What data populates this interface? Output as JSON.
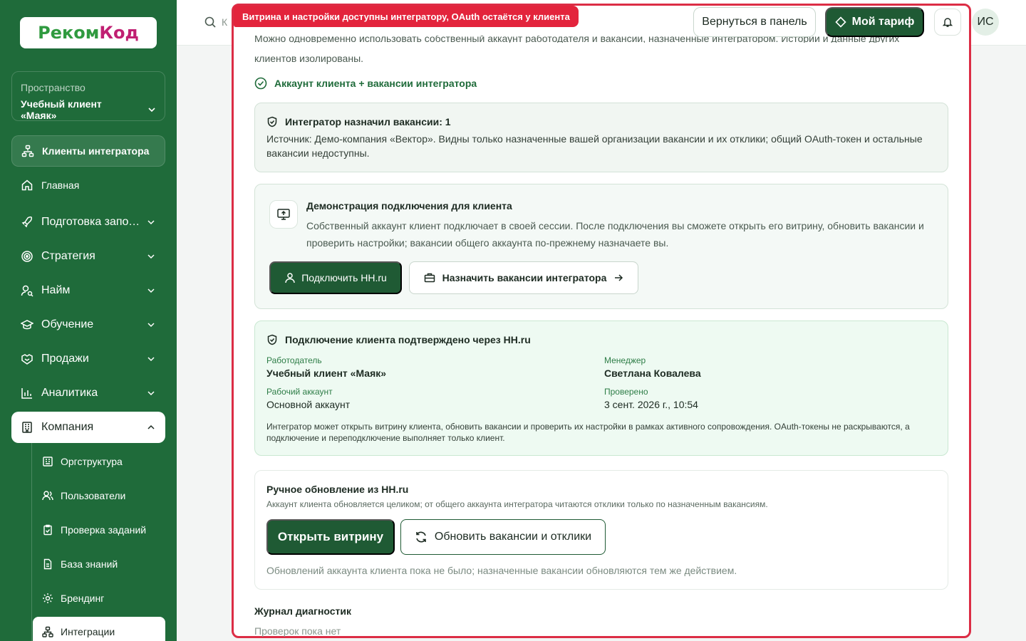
{
  "sidebar": {
    "logo_text_a": "Реком",
    "logo_text_b": "Код",
    "space_label": "Пространство",
    "space_value": "Учебный клиент «Маяк»",
    "items": [
      {
        "label": "Клиенты интегратора",
        "icon": "clients-network-icon"
      },
      {
        "label": "Главная",
        "icon": "home-icon"
      },
      {
        "label": "Подготовка заполнения",
        "icon": "rocket-icon"
      },
      {
        "label": "Стратегия",
        "icon": "target-icon"
      },
      {
        "label": "Найм",
        "icon": "user-search-icon"
      },
      {
        "label": "Обучение",
        "icon": "graduation-icon"
      },
      {
        "label": "Продажи",
        "icon": "handshake-icon"
      },
      {
        "label": "Аналитика",
        "icon": "bar-chart-icon"
      },
      {
        "label": "Компания",
        "icon": "building-icon"
      }
    ],
    "subitems": [
      {
        "label": "Оргструктура",
        "icon": "org-icon"
      },
      {
        "label": "Пользователи",
        "icon": "users-icon"
      },
      {
        "label": "Проверка заданий",
        "icon": "clipboard-check-icon"
      },
      {
        "label": "База знаний",
        "icon": "document-icon"
      },
      {
        "label": "Брендинг",
        "icon": "gear-icon"
      },
      {
        "label": "Интеграции",
        "icon": "integration-icon"
      }
    ]
  },
  "topbar": {
    "search_placeholder": "К",
    "back_label": "Вернуться в панель",
    "plan_label": "Мой тариф",
    "avatar_initials": "ИС"
  },
  "modal": {
    "tag": "Витрина и настройки доступны интегратору, OAuth остаётся у клиента",
    "clipped_text_line1": "Можно одновременно использовать собственный аккаунт работодателя и вакансии, назначенные интегратором. Истории и данные других",
    "clipped_text_line2": "клиентов изолированы.",
    "status": "Аккаунт клиента + вакансии интегратора",
    "assigned": {
      "title": "Интегратор назначил вакансии: 1",
      "text": "Источник: Демо-компания «Вектор». Видны только назначенные вашей организации вакансии и их отклики; общий OAuth-токен и остальные вакансии недоступны."
    },
    "demo": {
      "title": "Демонстрация подключения для клиента",
      "text": "Собственный аккаунт клиент подключает в своей сессии. После подключения вы сможете открыть его витрину, обновить вакансии и проверить настройки; вакансии общего аккаунта по-прежнему назначаете вы.",
      "connect_label": "Подключить HH.ru",
      "assign_label": "Назначить вакансии интегратора"
    },
    "connection": {
      "title": "Подключение клиента подтверждено через HH.ru",
      "employer_key": "Работодатель",
      "employer_val": "Учебный клиент «Маяк»",
      "manager_key": "Менеджер",
      "manager_val": "Светлана Ковалева",
      "account_key": "Рабочий аккаунт",
      "account_val": "Основной аккаунт",
      "checked_key": "Проверено",
      "checked_val": "3 сент. 2026 г., 10:54",
      "note": "Интегратор может открыть витрину клиента, обновить вакансии и проверить их настройки в рамках активного сопровождения. OAuth-токены не раскрываются, а подключение и переподключение выполняет только клиент."
    },
    "manual": {
      "title": "Ручное обновление из HH.ru",
      "subtitle": "Аккаунт клиента обновляется целиком; от общего аккаунта интегратора читаются отклики только по назначенным вакансиям.",
      "open_label": "Открыть витрину",
      "refresh_label": "Обновить вакансии и отклики",
      "note": "Обновлений аккаунта клиента пока не было; назначенные вакансии обновляются тем же действием."
    },
    "journal_title": "Журнал диагностик",
    "journal_empty": "Проверок пока нет"
  },
  "colors": {
    "brand": "#1f6b3a",
    "accent_dark": "#1f5a34",
    "alert": "#dc2d45"
  }
}
